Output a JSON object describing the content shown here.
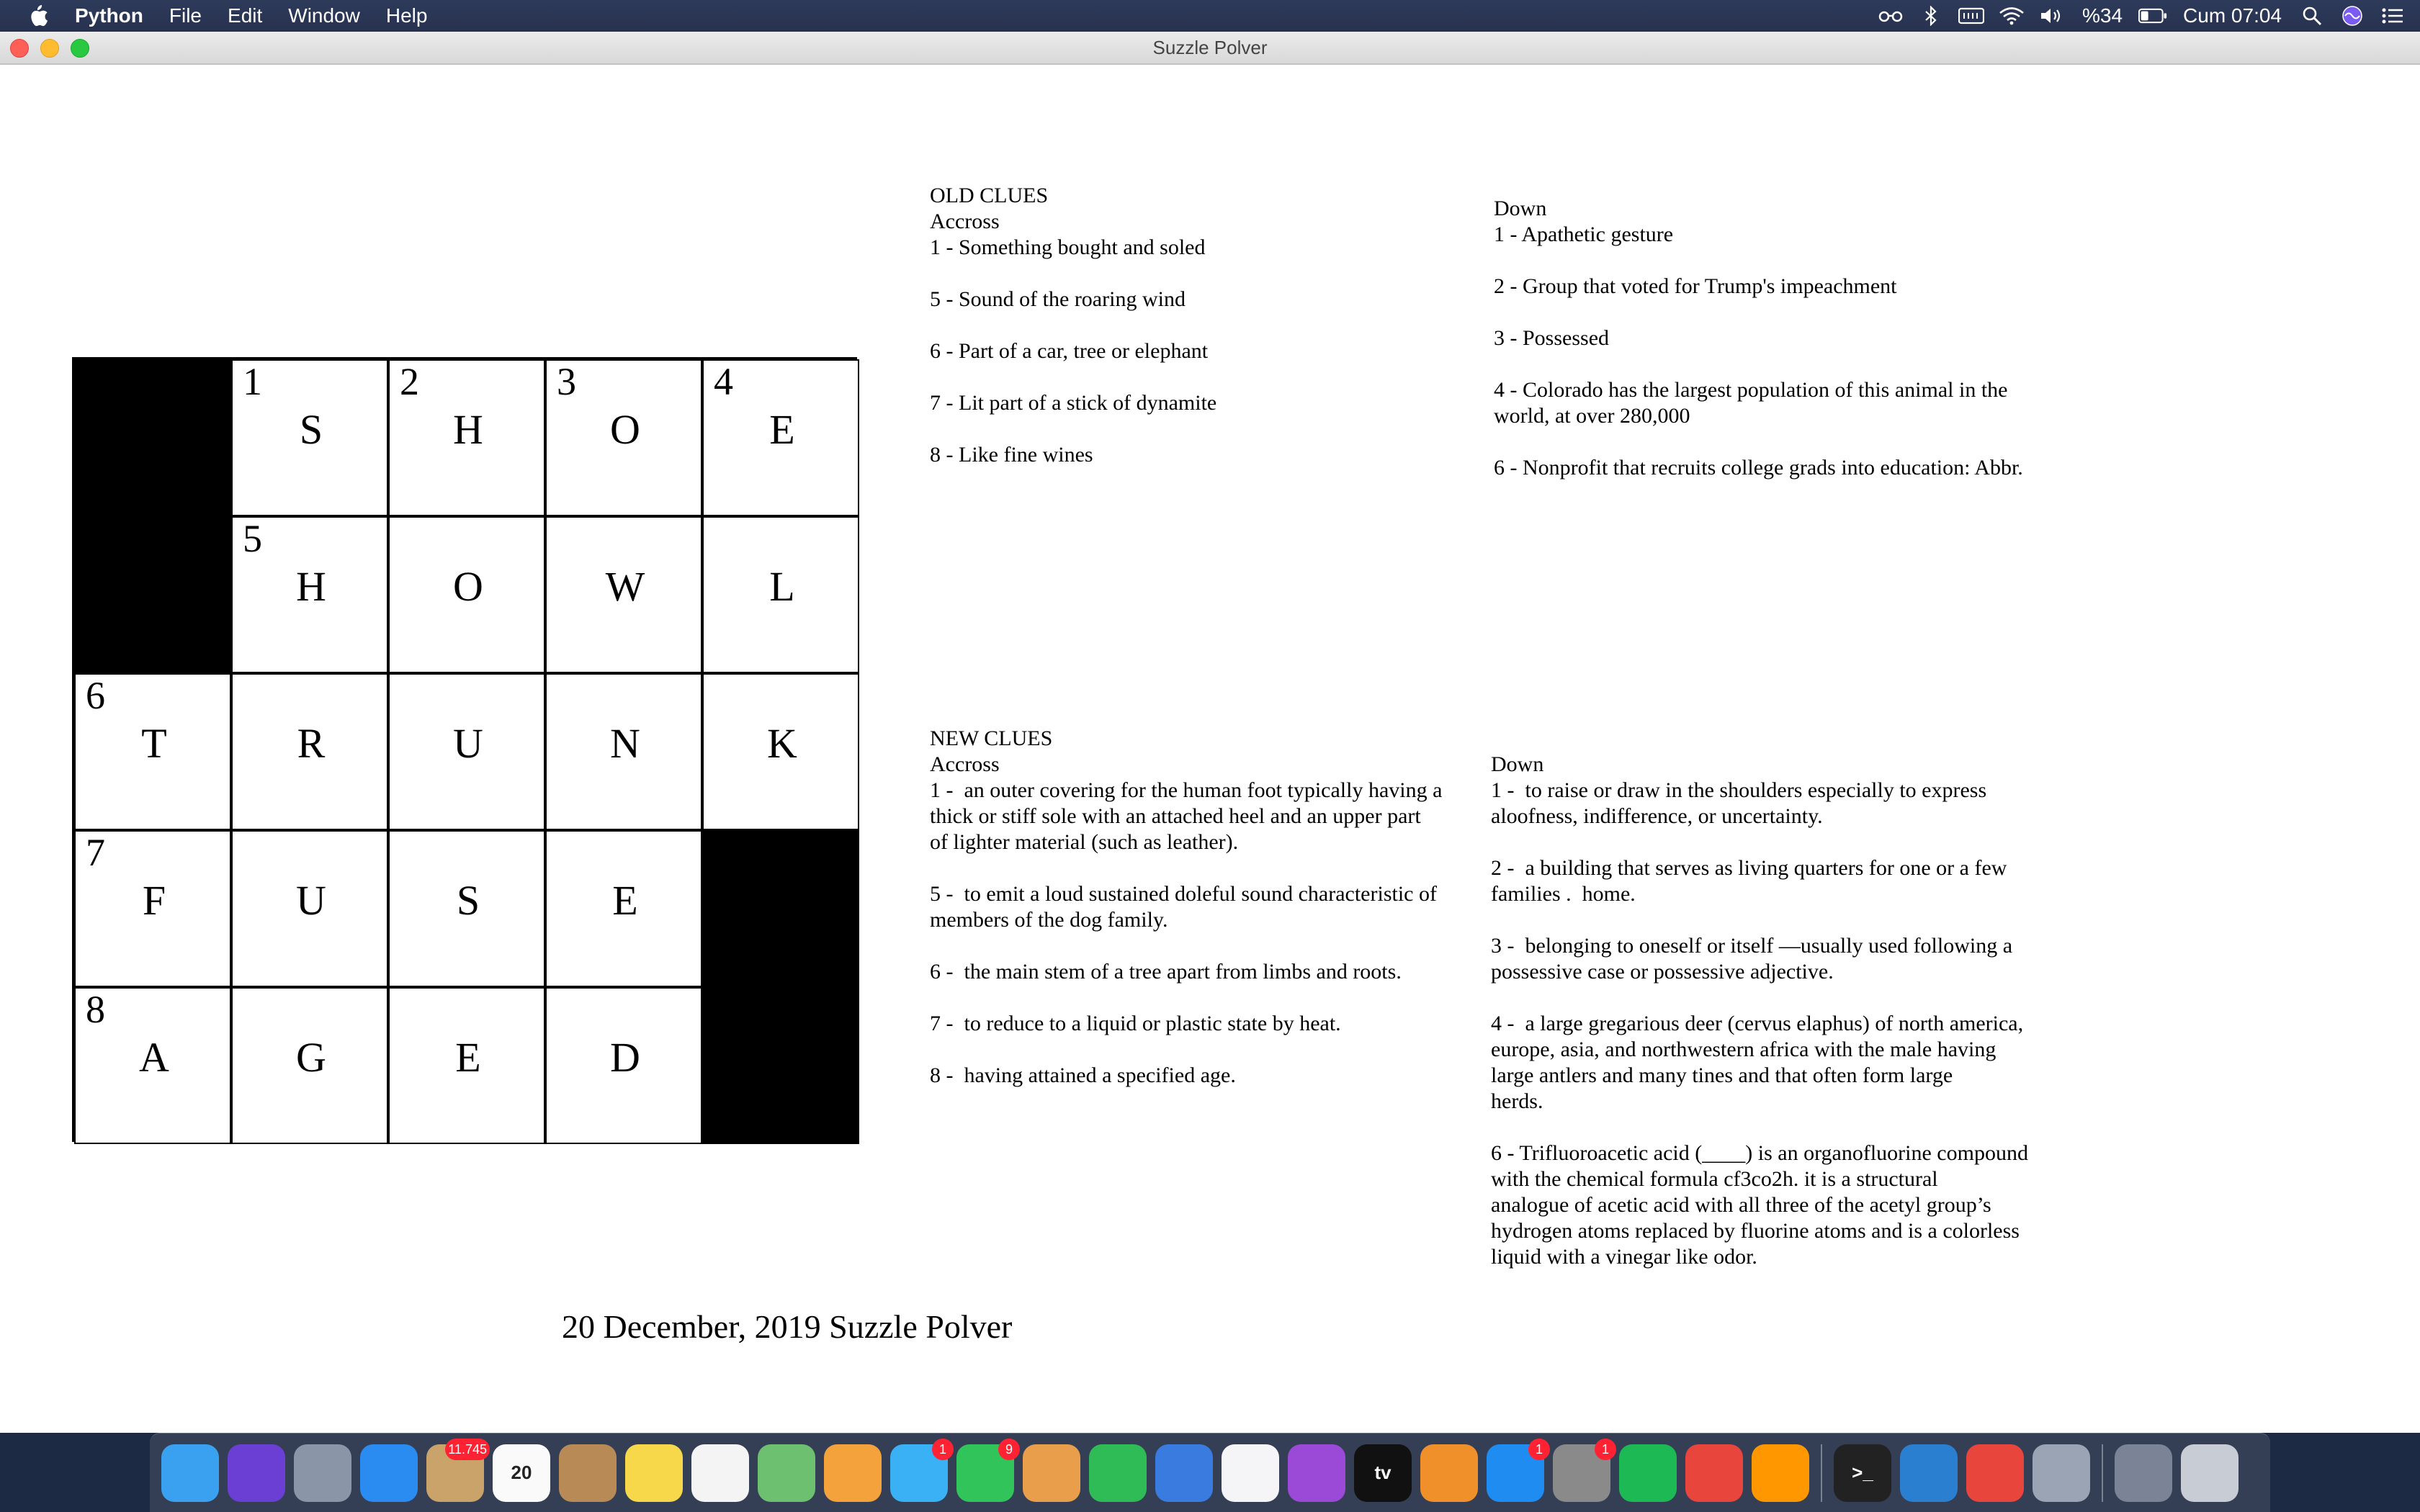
{
  "menubar": {
    "app_name": "Python",
    "items": [
      "File",
      "Edit",
      "Window",
      "Help"
    ],
    "battery_percent": "%34",
    "clock": "Cum 07:04"
  },
  "window": {
    "title": "Suzzle Polver"
  },
  "grid": {
    "cells": [
      [
        {
          "black": true
        },
        {
          "num": "1",
          "letter": "S"
        },
        {
          "num": "2",
          "letter": "H"
        },
        {
          "num": "3",
          "letter": "O"
        },
        {
          "num": "4",
          "letter": "E"
        }
      ],
      [
        {
          "black": true
        },
        {
          "num": "5",
          "letter": "H"
        },
        {
          "letter": "O"
        },
        {
          "letter": "W"
        },
        {
          "letter": "L"
        }
      ],
      [
        {
          "num": "6",
          "letter": "T"
        },
        {
          "letter": "R"
        },
        {
          "letter": "U"
        },
        {
          "letter": "N"
        },
        {
          "letter": "K"
        }
      ],
      [
        {
          "num": "7",
          "letter": "F"
        },
        {
          "letter": "U"
        },
        {
          "letter": "S"
        },
        {
          "letter": "E"
        },
        {
          "black": true
        }
      ],
      [
        {
          "num": "8",
          "letter": "A"
        },
        {
          "letter": "G"
        },
        {
          "letter": "E"
        },
        {
          "letter": "D"
        },
        {
          "black": true
        }
      ]
    ]
  },
  "old_clues": {
    "heading": "OLD CLUES",
    "across_label": "Accross",
    "across": "1 - Something bought and soled\n\n5 - Sound of the roaring wind\n\n6 - Part of a car, tree or elephant\n\n7 - Lit part of a stick of dynamite\n\n8 - Like fine wines",
    "down_label": "Down",
    "down": "1 - Apathetic gesture\n\n2 - Group that voted for Trump's impeachment\n\n3 - Possessed\n\n4 - Colorado has the largest population of this animal in the\nworld, at over 280,000\n\n6 - Nonprofit that recruits college grads into education: Abbr."
  },
  "new_clues": {
    "heading": "NEW CLUES",
    "across_label": "Accross",
    "across": "1 -  an outer covering for the human foot typically having a\nthick or stiff sole with an attached heel and an upper part\nof lighter material (such as leather).\n\n5 -  to emit a loud sustained doleful sound characteristic of\nmembers of the dog family.\n\n6 -  the main stem of a tree apart from limbs and roots.\n\n7 -  to reduce to a liquid or plastic state by heat.\n\n8 -  having attained a specified age.",
    "down_label": "Down",
    "down": "1 -  to raise or draw in the shoulders especially to express\naloofness, indifference, or uncertainty.\n\n2 -  a building that serves as living quarters for one or a few\nfamilies .  home.\n\n3 -  belonging to oneself or itself —usually used following a\npossessive case or possessive adjective.\n\n4 -  a large gregarious deer (cervus elaphus) of north america,\neurope, asia, and northwestern africa with the male having\nlarge antlers and many tines and that often form large\nherds.\n\n6 - Trifluoroacetic acid (____) is an organofluorine compound\nwith the chemical formula cf3co2h. it is a structural\nanalogue of acetic acid with all three of the acetyl group’s\nhydrogen atoms replaced by fluorine atoms and is a colorless\nliquid with a vinegar like odor."
  },
  "date_caption": "20 December, 2019 Suzzle Polver",
  "dock": {
    "items": [
      {
        "name": "finder",
        "color": "#3aa0f0"
      },
      {
        "name": "siri",
        "color": "#6b3fd4"
      },
      {
        "name": "launchpad",
        "color": "#8a96a8"
      },
      {
        "name": "safari",
        "color": "#2a8cf0"
      },
      {
        "name": "mail",
        "color": "#c9a36a",
        "badge": "11.745"
      },
      {
        "name": "calendar",
        "color": "#fafafa",
        "label": "20",
        "label_color": "#222"
      },
      {
        "name": "contacts",
        "color": "#b88a55"
      },
      {
        "name": "notes",
        "color": "#f6d84a"
      },
      {
        "name": "reminders",
        "color": "#f4f4f4"
      },
      {
        "name": "maps",
        "color": "#6cc070"
      },
      {
        "name": "photos",
        "color": "#f4a23c"
      },
      {
        "name": "messages",
        "color": "#3ab0f5",
        "badge": "1"
      },
      {
        "name": "facetime",
        "color": "#30c45a",
        "badge": "9"
      },
      {
        "name": "preview",
        "color": "#e89e4a"
      },
      {
        "name": "numbers",
        "color": "#2fbb55"
      },
      {
        "name": "keynote",
        "color": "#3a7be0"
      },
      {
        "name": "music",
        "color": "#f5f5f7"
      },
      {
        "name": "podcasts",
        "color": "#9b4ad8"
      },
      {
        "name": "tv",
        "color": "#111",
        "label": "tv"
      },
      {
        "name": "books",
        "color": "#f0902a"
      },
      {
        "name": "app-store",
        "color": "#1e8cf0",
        "badge": "1"
      },
      {
        "name": "system-preferences",
        "color": "#8a8a8a",
        "badge": "1"
      },
      {
        "name": "spotify",
        "color": "#1db954"
      },
      {
        "name": "chrome",
        "color": "#e8453c"
      },
      {
        "name": "sublime-text",
        "color": "#ff9800"
      },
      {
        "sep": true
      },
      {
        "name": "terminal",
        "color": "#222",
        "label": ">_"
      },
      {
        "name": "vscode",
        "color": "#2a7fd0"
      },
      {
        "name": "chrome-2",
        "color": "#e8453c"
      },
      {
        "name": "rocket",
        "color": "#9aa4b4"
      },
      {
        "sep": true
      },
      {
        "name": "downloads-stack",
        "color": "#7a8496"
      },
      {
        "name": "trash",
        "color": "#c8ccd4"
      }
    ]
  }
}
